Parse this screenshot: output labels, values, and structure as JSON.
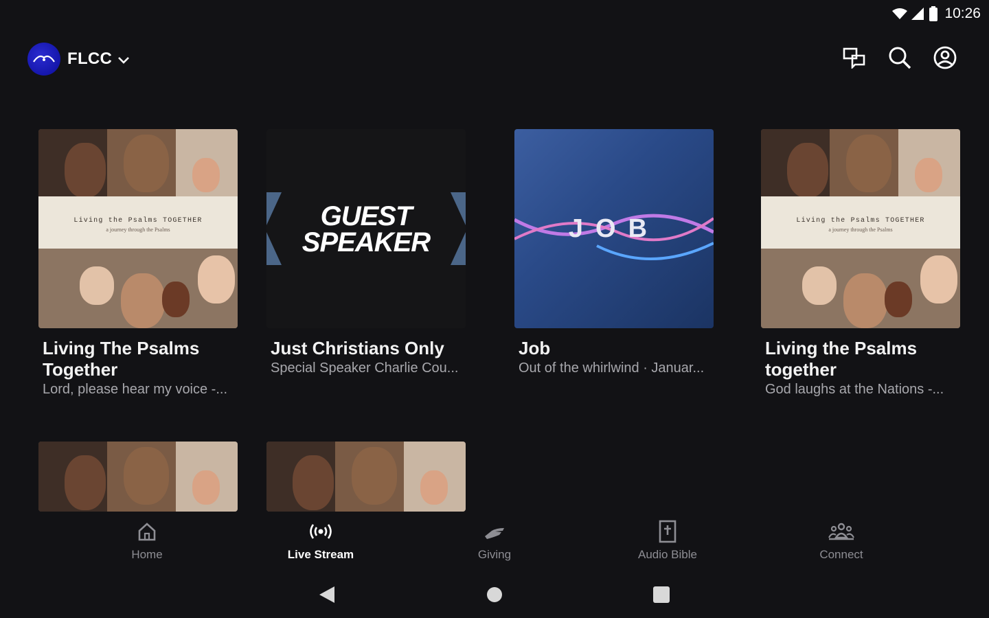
{
  "status": {
    "time": "10:26"
  },
  "header": {
    "org_name": "FLCC"
  },
  "cards": [
    {
      "title": "Living The Psalms Together",
      "subtitle": "Lord, please hear my voice -...",
      "art": "psalms"
    },
    {
      "title": "Just Christians Only",
      "subtitle": "Special Speaker Charlie Cou...",
      "art": "guest",
      "art_text": "GUEST SPEAKER"
    },
    {
      "title": "Job",
      "subtitle": "Out of the whirlwind · Januar...",
      "art": "job",
      "art_text": "JOB"
    },
    {
      "title": "Living the Psalms together",
      "subtitle": "God laughs at the Nations -...",
      "art": "psalms"
    }
  ],
  "psalms_art": {
    "band_title": "Living the Psalms TOGETHER",
    "band_sub": "a journey through the Psalms"
  },
  "bottom_nav": [
    {
      "label": "Home",
      "icon": "home-icon",
      "active": false
    },
    {
      "label": "Live Stream",
      "icon": "live-stream-icon",
      "active": true
    },
    {
      "label": "Giving",
      "icon": "giving-icon",
      "active": false
    },
    {
      "label": "Audio Bible",
      "icon": "bible-icon",
      "active": false
    },
    {
      "label": "Connect",
      "icon": "connect-icon",
      "active": false
    }
  ],
  "colors": {
    "background": "#121215",
    "brand": "#1414c4",
    "inactive": "#8e8e94"
  }
}
